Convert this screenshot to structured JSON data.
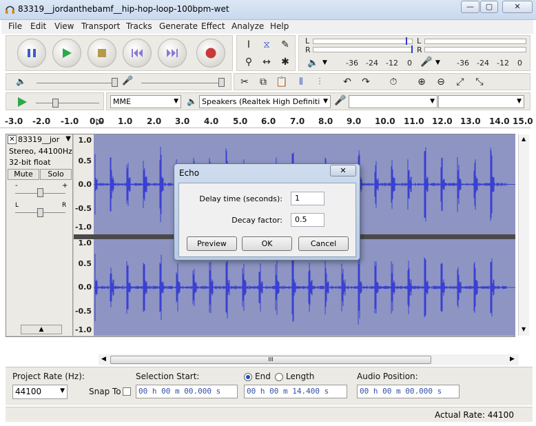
{
  "window": {
    "title": "83319__jordanthebamf__hip-hop-loop-100bpm-wet",
    "minimize": "—",
    "maximize": "▢",
    "close": "✕"
  },
  "menu": [
    "File",
    "Edit",
    "View",
    "Transport",
    "Tracks",
    "Generate",
    "Effect",
    "Analyze",
    "Help"
  ],
  "meters": {
    "playback_l": "L",
    "playback_r": "R",
    "record_l": "L",
    "record_r": "R",
    "scale_play": [
      "-36",
      "-24",
      "-12",
      "0"
    ],
    "scale_rec": [
      "-36",
      "-24",
      "-12",
      "0"
    ]
  },
  "device": {
    "host": "MME",
    "output": "Speakers (Realtek High Definiti",
    "input": "",
    "channels": ""
  },
  "ruler": [
    "-3.0",
    "-2.0",
    "-1.0",
    "0.0",
    "1.0",
    "2.0",
    "3.0",
    "4.0",
    "5.0",
    "6.0",
    "7.0",
    "8.0",
    "9.0",
    "10.0",
    "11.0",
    "12.0",
    "13.0",
    "14.0",
    "15.0"
  ],
  "track": {
    "name": "83319__jor",
    "format": "Stereo, 44100Hz",
    "bit": "32-bit float",
    "mute": "Mute",
    "solo": "Solo",
    "gain_minus": "-",
    "gain_plus": "+",
    "pan_l": "L",
    "pan_r": "R",
    "vscale": [
      "1.0",
      "0.5",
      "0.0",
      "-0.5",
      "-1.0"
    ]
  },
  "dialog": {
    "title": "Echo",
    "delay_label": "Delay time (seconds):",
    "delay_value": "1",
    "decay_label": "Decay factor:",
    "decay_value": "0.5",
    "preview": "Preview",
    "ok": "OK",
    "cancel": "Cancel"
  },
  "scroll": {
    "grip": "III"
  },
  "selection": {
    "rate_label": "Project Rate (Hz):",
    "rate_value": "44100",
    "snap_label": "Snap To",
    "start_label": "Selection Start:",
    "end_label": "End",
    "length_label": "Length",
    "audio_pos_label": "Audio Position:",
    "start_value": "00 h 00 m 00.000 s",
    "end_value": "00 h 00 m 14.400 s",
    "audio_pos_value": "00 h 00 m 00.000 s"
  },
  "status": {
    "actual_rate": "Actual Rate: 44100"
  }
}
